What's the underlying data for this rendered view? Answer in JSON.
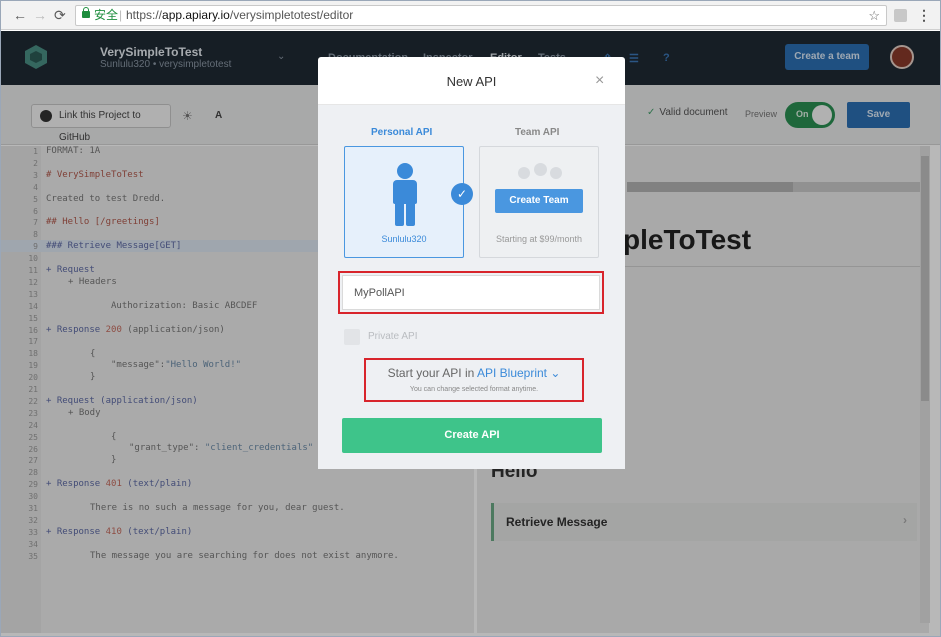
{
  "browser": {
    "back": "←",
    "forward": "→",
    "reload": "⟳",
    "secure_label": "安全",
    "separator": "|",
    "url_prefix": "https://",
    "url_host": "app.apiary.io",
    "url_path": "/verysimpletotest/editor",
    "star": "☆",
    "menu": "⋮"
  },
  "topbar": {
    "project_title": "VerySimpleToTest",
    "project_subtitle": "Sunlulu320 • verysimpletotest",
    "tabs": [
      "Documentation",
      "Inspector",
      "Editor",
      "Tests"
    ],
    "create_team": "Create a team"
  },
  "toolbar": {
    "github_link": "Link this Project to GitHub",
    "font_toggle": "A",
    "valid_check": "✓",
    "valid": "Valid document",
    "preview": "Preview",
    "toggle": "On",
    "save": "Save"
  },
  "editor": {
    "lines": [
      "1",
      "2",
      "3",
      "4",
      "5",
      "6",
      "7",
      "8",
      "9",
      "10",
      "11",
      "12",
      "13",
      "14",
      "15",
      "16",
      "17",
      "18",
      "19",
      "20",
      "21",
      "22",
      "23",
      "24",
      "25",
      "26",
      "27",
      "28",
      "29",
      "30",
      "31",
      "32",
      "33",
      "34",
      "35"
    ],
    "code": {
      "l1": "FORMAT: 1A",
      "l3": "# VerySimpleToTest",
      "l5": "Created to test Dredd.",
      "l7": "## Hello [/greetings]",
      "l9": "### Retrieve Message[GET]",
      "l11": "+ Request",
      "l12": "+ Headers",
      "l14": "Authorization: Basic ABCDEF",
      "l16a": "+ Response ",
      "l16b": "200",
      "l16c": " (application/json)",
      "l18": "{",
      "l19a": "\"message\":",
      "l19b": "\"Hello World!\"",
      "l20": "}",
      "l22": "+ Request (application/json)",
      "l23": "+ Body",
      "l25": "{",
      "l26a": "\"grant_type\": ",
      "l26b": "\"client_credentials\"",
      "l27": "}",
      "l29a": "+ Response ",
      "l29b": "401",
      "l29c": " (text/plain)",
      "l31": "There is no such a message for you, dear guest.",
      "l33a": "+ Response ",
      "l33b": "410",
      "l33c": " (text/plain)",
      "l35": "The message you are searching for does not exist anymore."
    }
  },
  "preview": {
    "title": "pleToTest",
    "hello": "Hello",
    "retrieve": "Retrieve Message",
    "chevron": "›"
  },
  "modal": {
    "title": "New API",
    "close": "×",
    "personal_label": "Personal API",
    "team_label": "Team API",
    "check": "✓",
    "personal_name": "Sunlulu320",
    "create_team": "Create Team",
    "team_price": "Starting at $99/month",
    "api_name_value": "MyPollAPI",
    "private_label": "Private API",
    "blueprint_prefix": "Start your API in ",
    "blueprint_format": "API Blueprint",
    "blueprint_chevron": "⌄",
    "blueprint_note": "You can change selected format anytime.",
    "create_button": "Create API"
  },
  "colors": {
    "topbar": "#1f2a34",
    "accent_blue": "#3b8ad9",
    "create_green": "#3ec48a",
    "annotation_red": "#d8242b"
  }
}
